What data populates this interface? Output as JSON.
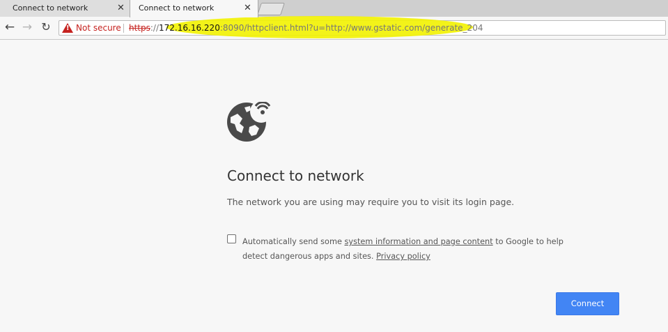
{
  "tabs": [
    {
      "title": "Connect to network"
    },
    {
      "title": "Connect to network"
    }
  ],
  "tab_close_glyph": "✕",
  "toolbar": {
    "back_glyph": "←",
    "forward_glyph": "→",
    "reload_glyph": "↻"
  },
  "omnibox": {
    "security_text": "Not secure",
    "url_scheme": "https",
    "url_sep": "://",
    "url_host": "172.16.16.220",
    "url_rest": ":8090/httpclient.html?u=http://www.gstatic.com/generate_204"
  },
  "page": {
    "title": "Connect to network",
    "subtitle": "The network you are using may require you to visit its login page.",
    "opt_text_1": "Automatically send some ",
    "opt_link_1": "system information and page content",
    "opt_text_2": " to Google to help detect dangerous apps and sites. ",
    "opt_link_2": "Privacy policy",
    "checkbox_checked": false,
    "connect_label": "Connect"
  },
  "icons": {
    "globe": "globe-wifi-icon",
    "warning": "warning-triangle-icon"
  },
  "colors": {
    "accent": "#4285f4",
    "warning": "#c5221f",
    "highlight": "#f2f200",
    "icon": "#4a4a4a"
  }
}
